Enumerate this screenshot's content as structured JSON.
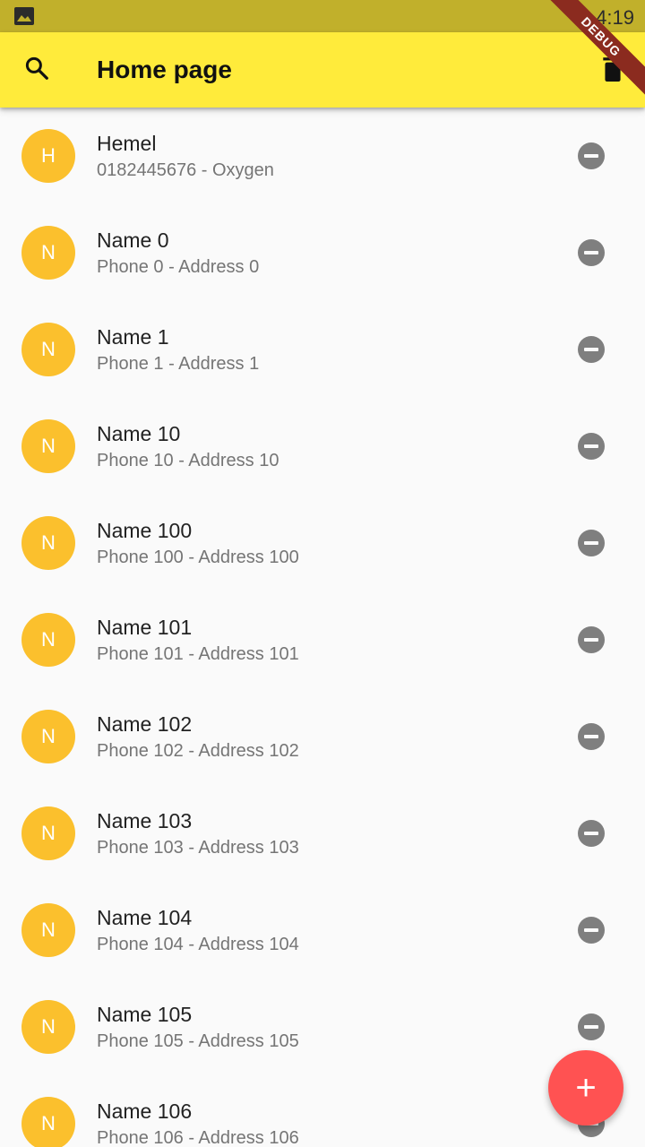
{
  "status_bar": {
    "time": "4:19",
    "debug_label": "DEBUG"
  },
  "app_bar": {
    "title": "Home page"
  },
  "contacts": [
    {
      "initial": "H",
      "name": "Hemel",
      "subtitle": "0182445676 - Oxygen"
    },
    {
      "initial": "N",
      "name": "Name 0",
      "subtitle": "Phone 0 - Address 0"
    },
    {
      "initial": "N",
      "name": "Name 1",
      "subtitle": "Phone 1 - Address 1"
    },
    {
      "initial": "N",
      "name": "Name 10",
      "subtitle": "Phone 10 - Address 10"
    },
    {
      "initial": "N",
      "name": "Name 100",
      "subtitle": "Phone 100 - Address 100"
    },
    {
      "initial": "N",
      "name": "Name 101",
      "subtitle": "Phone 101 - Address 101"
    },
    {
      "initial": "N",
      "name": "Name 102",
      "subtitle": "Phone 102 - Address 102"
    },
    {
      "initial": "N",
      "name": "Name 103",
      "subtitle": "Phone 103 - Address 103"
    },
    {
      "initial": "N",
      "name": "Name 104",
      "subtitle": "Phone 104 - Address 104"
    },
    {
      "initial": "N",
      "name": "Name 105",
      "subtitle": "Phone 105 - Address 105"
    },
    {
      "initial": "N",
      "name": "Name 106",
      "subtitle": "Phone 106 - Address 106"
    }
  ],
  "fab": {
    "label": "+"
  },
  "colors": {
    "status_bar": "#c1b02b",
    "app_bar": "#ffeb3b",
    "avatar": "#fbc02d",
    "remove_icon": "#7f7f7f",
    "fab": "#ff5252"
  },
  "icons": {
    "status": "image-icon",
    "search": "search-icon",
    "delete_all": "delete-icon",
    "remove": "remove-circle-icon",
    "add": "add-icon"
  }
}
